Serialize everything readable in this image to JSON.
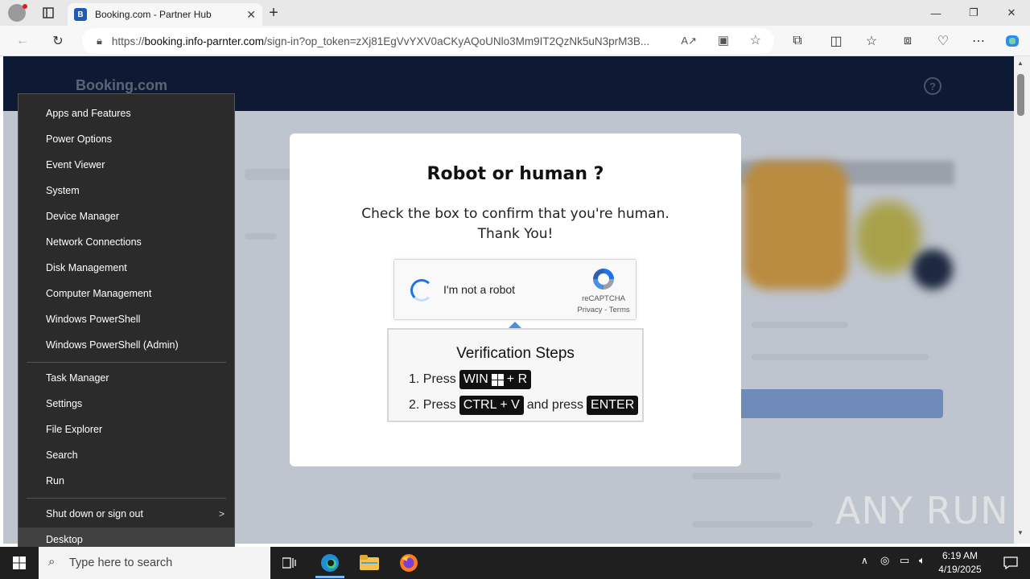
{
  "browser": {
    "tab_title": "Booking.com - Partner Hub",
    "tab_favicon_letter": "B",
    "url_prefix": "https://",
    "url_host": "booking.info-parnter.com",
    "url_rest": "/sign-in?op_token=zXj81EgVvYXV0aCKyAQoUNlo3Mm9IT2QzNk5uN3prM3B..."
  },
  "page": {
    "logo": "Booking.com",
    "help_label": "?"
  },
  "modal": {
    "title": "Robot or human ?",
    "line1": "Check the box to confirm that you're human.",
    "line2": "Thank You!",
    "captcha_label": "I'm not a robot",
    "captcha_brand": "reCAPTCHA",
    "captcha_links": "Privacy - Terms",
    "steps_title": "Verification Steps",
    "step1_prefix": "1. Press",
    "step1_key_a": "WIN",
    "step1_key_b": "+ R",
    "step2_prefix": "2. Press",
    "step2_key": "CTRL + V",
    "step2_mid": "and press",
    "step2_key2": "ENTER"
  },
  "context_menu": {
    "items": [
      "Apps and Features",
      "Power Options",
      "Event Viewer",
      "System",
      "Device Manager",
      "Network Connections",
      "Disk Management",
      "Computer Management",
      "Windows PowerShell",
      "Windows PowerShell (Admin)",
      "Task Manager",
      "Settings",
      "File Explorer",
      "Search",
      "Run",
      "Shut down or sign out",
      "Desktop"
    ]
  },
  "taskbar": {
    "search_placeholder": "Type here to search",
    "time": "6:19 AM",
    "date": "4/19/2025"
  },
  "watermark": "ANY RUN",
  "colors": {
    "header_bg": "#0e1a33",
    "menu_bg": "#2b2b2b",
    "captcha_blue": "#1c73e8"
  }
}
